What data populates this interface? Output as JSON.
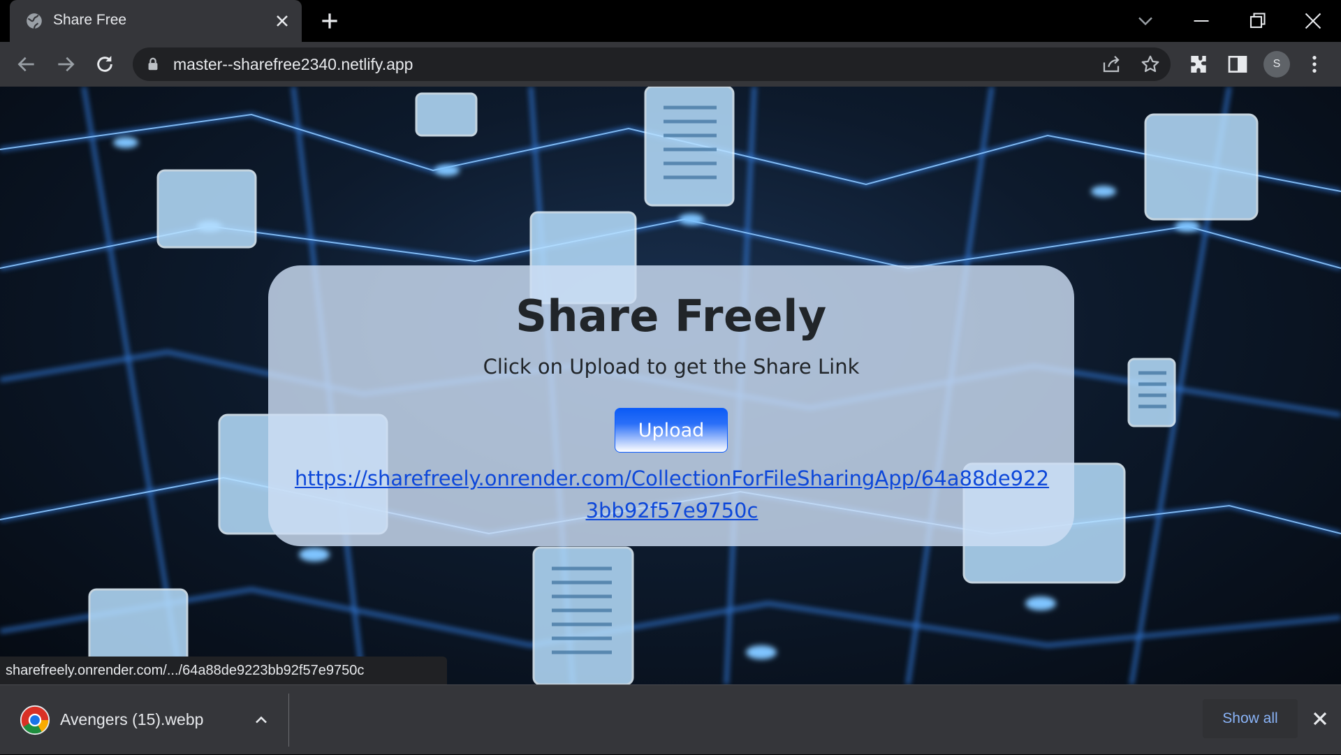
{
  "browser": {
    "tab_title": "Share Free",
    "url": "master--sharefree2340.netlify.app",
    "profile_initial": "S"
  },
  "page": {
    "title": "Share Freely",
    "subtitle": "Click on Upload to get the Share Link",
    "upload_label": "Upload",
    "share_link": "https://sharefreely.onrender.com/CollectionForFileSharingApp/64a88de9223bb92f57e9750c"
  },
  "status_bar": {
    "hover_url": "sharefreely.onrender.com/.../64a88de9223bb92f57e9750c"
  },
  "downloads": {
    "file_name": "Avengers (15).webp",
    "show_all_label": "Show all"
  },
  "icons": {
    "favicon": "globe-icon",
    "tab_close": "close-icon",
    "new_tab": "plus-icon",
    "back": "arrow-left-icon",
    "forward": "arrow-right-icon",
    "reload": "reload-icon",
    "lock": "lock-icon",
    "share": "share-icon",
    "bookmark": "star-icon",
    "extensions": "puzzle-icon",
    "side_panel": "side-panel-icon",
    "menu": "kebab-menu-icon"
  },
  "colors": {
    "chrome_dark": "#35363a",
    "omnibox": "#202124",
    "link": "#0d47d9",
    "button": "#0b5bf5",
    "card": "#cddef4",
    "show_all_text": "#8ab4f8"
  }
}
